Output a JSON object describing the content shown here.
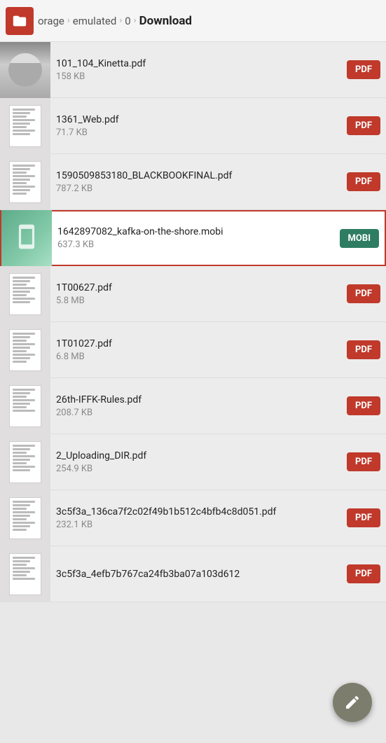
{
  "header": {
    "breadcrumb": {
      "storage": "orage",
      "sep1": "›",
      "emulated": "emulated",
      "sep2": "›",
      "zero": "0",
      "sep3": "›",
      "current": "Download"
    }
  },
  "files": [
    {
      "id": 1,
      "name": "101_104_Kinetta.pdf",
      "size": "158 KB",
      "type": "PDF",
      "selected": false,
      "thumbClass": "t1",
      "thumbType": "photo"
    },
    {
      "id": 2,
      "name": "1361_Web.pdf",
      "size": "71.7 KB",
      "type": "PDF",
      "selected": false,
      "thumbClass": "t2",
      "thumbType": "pdf"
    },
    {
      "id": 3,
      "name": "1590509853180_BLACKBOOKFINAL.pdf",
      "size": "787.2 KB",
      "type": "PDF",
      "selected": false,
      "thumbClass": "t3",
      "thumbType": "pdf"
    },
    {
      "id": 4,
      "name": "1642897082_kafka-on-the-shore.mobi",
      "size": "637.3 KB",
      "type": "MOBI",
      "selected": true,
      "thumbClass": "mobi-thumb",
      "thumbType": "mobi"
    },
    {
      "id": 5,
      "name": "1T00627.pdf",
      "size": "5.8 MB",
      "type": "PDF",
      "selected": false,
      "thumbClass": "t5",
      "thumbType": "pdf"
    },
    {
      "id": 6,
      "name": "1T01027.pdf",
      "size": "6.8 MB",
      "type": "PDF",
      "selected": false,
      "thumbClass": "t6",
      "thumbType": "pdf"
    },
    {
      "id": 7,
      "name": "26th-IFFK-Rules.pdf",
      "size": "208.7 KB",
      "type": "PDF",
      "selected": false,
      "thumbClass": "t7",
      "thumbType": "pdf"
    },
    {
      "id": 8,
      "name": "2_Uploading_DIR.pdf",
      "size": "254.9 KB",
      "type": "PDF",
      "selected": false,
      "thumbClass": "t8",
      "thumbType": "pdf"
    },
    {
      "id": 9,
      "name": "3c5f3a_136ca7f2c02f49b1b512c4bfb4c8d051.pdf",
      "size": "232.1 KB",
      "type": "PDF",
      "selected": false,
      "thumbClass": "t9",
      "thumbType": "pdf"
    },
    {
      "id": 10,
      "name": "3c5f3a_4efb7b767ca24fb3ba07a103d612",
      "size": "",
      "type": "PDF",
      "selected": false,
      "thumbClass": "t10",
      "thumbType": "pdf"
    }
  ],
  "fab": {
    "icon": "pencil-icon"
  },
  "badges": {
    "pdf_label": "PDF",
    "mobi_label": "MOBI"
  }
}
